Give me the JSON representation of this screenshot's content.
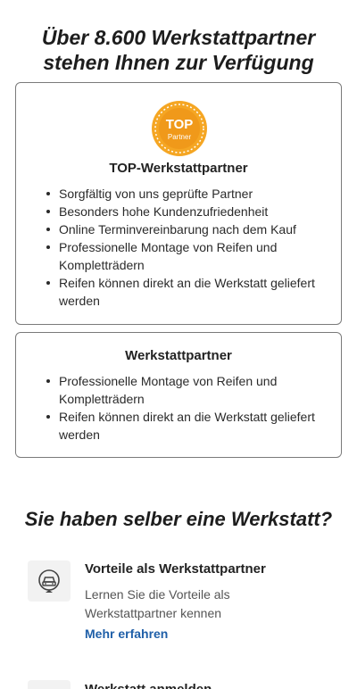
{
  "hero": {
    "title_line1": "Über 8.600 Werkstattpartner",
    "title_line2": "stehen Ihnen zur Verfügung"
  },
  "top_card": {
    "badge_line1": "TOP",
    "badge_line2": "Partner",
    "title": "TOP-Werkstattpartner",
    "features": [
      "Sorgfältig von uns geprüfte Partner",
      "Besonders hohe Kundenzufriedenheit",
      "Online Terminvereinbarung nach dem Kauf",
      "Professionelle Montage von Reifen und Kompletträdern",
      "Reifen können direkt an die Werkstatt geliefert werden"
    ]
  },
  "basic_card": {
    "title": "Werkstattpartner",
    "features": [
      "Professionelle Montage von Reifen und Kompletträdern",
      "Reifen können direkt an die Werkstatt geliefert werden"
    ]
  },
  "own_workshop": {
    "title": "Sie haben selber eine Werkstatt?",
    "benefits": [
      {
        "icon": "workshop-car-icon",
        "title": "Vorteile als Werkstattpartner",
        "desc_line1": "Lernen Sie die Vorteile als",
        "desc_line2": "Werkstattpartner kennen",
        "link": "Mehr erfahren"
      },
      {
        "icon": "workshop-register-icon",
        "title": "Werkstatt anmelden"
      }
    ]
  },
  "colors": {
    "badge_orange": "#F5A623",
    "link_blue": "#1F5FA8",
    "card_border": "#7A7A7A"
  }
}
